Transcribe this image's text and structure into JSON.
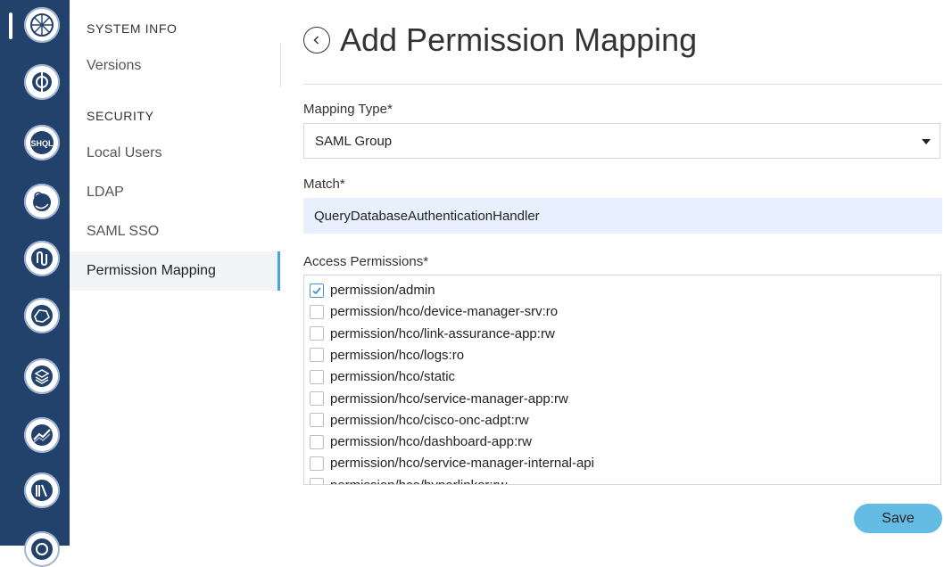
{
  "rail": {
    "icons": [
      "app-logo-icon",
      "chart-globe-icon",
      "shql-icon",
      "satellite-icon",
      "link-chain-icon",
      "map-network-icon",
      "layers-icon",
      "trend-chart-icon",
      "library-icon",
      "target-icon"
    ],
    "shql_text": "SHQL"
  },
  "subnav": {
    "system_info_title": "SYSTEM INFO",
    "versions": "Versions",
    "security_title": "SECURITY",
    "local_users": "Local Users",
    "ldap": "LDAP",
    "saml_sso": "SAML SSO",
    "permission_mapping": "Permission Mapping"
  },
  "page": {
    "title": "Add Permission Mapping"
  },
  "form": {
    "mapping_type_label": "Mapping Type*",
    "mapping_type_value": "SAML Group",
    "match_label": "Match*",
    "match_value": "QueryDatabaseAuthenticationHandler",
    "access_permissions_label": "Access Permissions*",
    "permissions": [
      {
        "label": "permission/admin",
        "checked": true
      },
      {
        "label": "permission/hco/device-manager-srv:ro",
        "checked": false
      },
      {
        "label": "permission/hco/link-assurance-app:rw",
        "checked": false
      },
      {
        "label": "permission/hco/logs:ro",
        "checked": false
      },
      {
        "label": "permission/hco/static",
        "checked": false
      },
      {
        "label": "permission/hco/service-manager-app:rw",
        "checked": false
      },
      {
        "label": "permission/hco/cisco-onc-adpt:rw",
        "checked": false
      },
      {
        "label": "permission/hco/dashboard-app:rw",
        "checked": false
      },
      {
        "label": "permission/hco/service-manager-internal-api",
        "checked": false
      },
      {
        "label": "permission/hco/hyperlinker:rw",
        "checked": false
      }
    ],
    "save_label": "Save"
  },
  "colors": {
    "rail_bg": "#22416b",
    "active_indicator": "#4aa3df",
    "save_button": "#64bbe3",
    "match_field_bg": "#e8f0fe",
    "checkbox_check": "#4a90d9"
  }
}
